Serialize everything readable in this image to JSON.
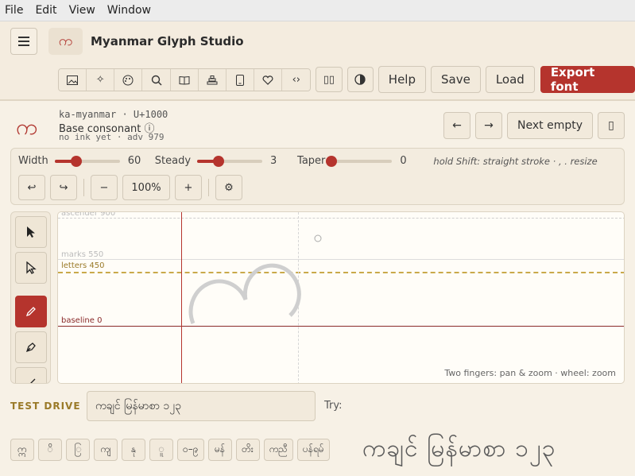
{
  "menu": {
    "items": [
      "File",
      "Edit",
      "View",
      "Window"
    ]
  },
  "app": {
    "title": "Myanmar Glyph Studio",
    "logo_glyph": "က"
  },
  "toolbar": {
    "icons": [
      "image-icon",
      "sparkle-icon",
      "palette-icon",
      "search-icon",
      "book-icon",
      "stack-icon",
      "phone-icon",
      "heart-icon",
      "code-icon"
    ],
    "help": "Help",
    "save": "Save",
    "load": "Load",
    "export": "Export font"
  },
  "glyph": {
    "preview": "က",
    "name_line": "ka-myanmar · U+1000",
    "category": "Base consonant ⓘ",
    "status": "no ink yet · adv 979"
  },
  "nav": {
    "prev": "←",
    "next": "→",
    "next_empty": "Next empty",
    "bookmark": "▯"
  },
  "brush": {
    "width_label": "Width",
    "width_value": "60",
    "width_level": 0.33,
    "steady_label": "Steady",
    "steady_value": "3",
    "steady_level": 0.33,
    "taper_label": "Taper",
    "taper_value": "0",
    "taper_level": 0.0,
    "hint": "hold Shift: straight stroke · , . resize"
  },
  "controls": {
    "undo": "↩",
    "redo": "↪",
    "zoom_out": "−",
    "zoom": "100%",
    "zoom_in": "+",
    "settings": "⚙"
  },
  "tools": [
    "select-tool",
    "direct-select-tool",
    "pencil-tool",
    "pen-tool",
    "line-tool"
  ],
  "canvas": {
    "ascender": "ascender 900",
    "marks": "marks 550",
    "letters": "letters 450",
    "baseline": "baseline 0",
    "hint": "Two fingers: pan & zoom · wheel: zoom"
  },
  "test": {
    "label": "TEST DRIVE",
    "input_value": "ကချင် မြန်မာစာ ၁၂၃",
    "try_label": "Try:",
    "samples": [
      "ဣ",
      "ိ",
      "ြ",
      "ကျ",
      "နု",
      "ူ",
      "၀–၉",
      "မန်",
      "တိး",
      "ကညီ",
      "ပန်ရမ်"
    ],
    "preview": "ကချင် မြန်မာစာ ၁၂၃"
  }
}
